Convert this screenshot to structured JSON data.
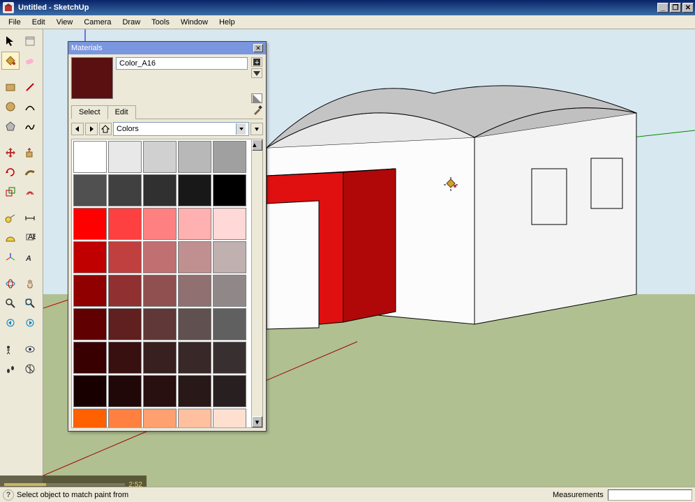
{
  "window": {
    "title": "Untitled - SketchUp"
  },
  "menu": [
    "File",
    "Edit",
    "View",
    "Camera",
    "Draw",
    "Tools",
    "Window",
    "Help"
  ],
  "materials_panel": {
    "title": "Materials",
    "current_name": "Color_A16",
    "tab_select": "Select",
    "tab_edit": "Edit",
    "dropdown": "Colors",
    "swatch_hex": "#5a1010",
    "colors": [
      "#ffffff",
      "#e8e8e8",
      "#d0d0d0",
      "#b8b8b8",
      "#a0a0a0",
      "#505050",
      "#404040",
      "#303030",
      "#181818",
      "#000000",
      "#ff0000",
      "#ff4040",
      "#ff8080",
      "#ffb0b0",
      "#ffd8d8",
      "#c00000",
      "#c04040",
      "#c07070",
      "#c09090",
      "#c0b0b0",
      "#900000",
      "#903030",
      "#905050",
      "#907070",
      "#908888",
      "#600000",
      "#602020",
      "#603838",
      "#605050",
      "#606060",
      "#380000",
      "#381010",
      "#382020",
      "#382828",
      "#383030",
      "#180000",
      "#200808",
      "#281010",
      "#281818",
      "#282020",
      "#ff6000",
      "#ff8040",
      "#ffa070",
      "#ffc0a0",
      "#ffe0d0"
    ]
  },
  "status": {
    "hint": "Select object to match paint from",
    "measurements_label": "Measurements"
  },
  "video": {
    "time": "2:52"
  }
}
